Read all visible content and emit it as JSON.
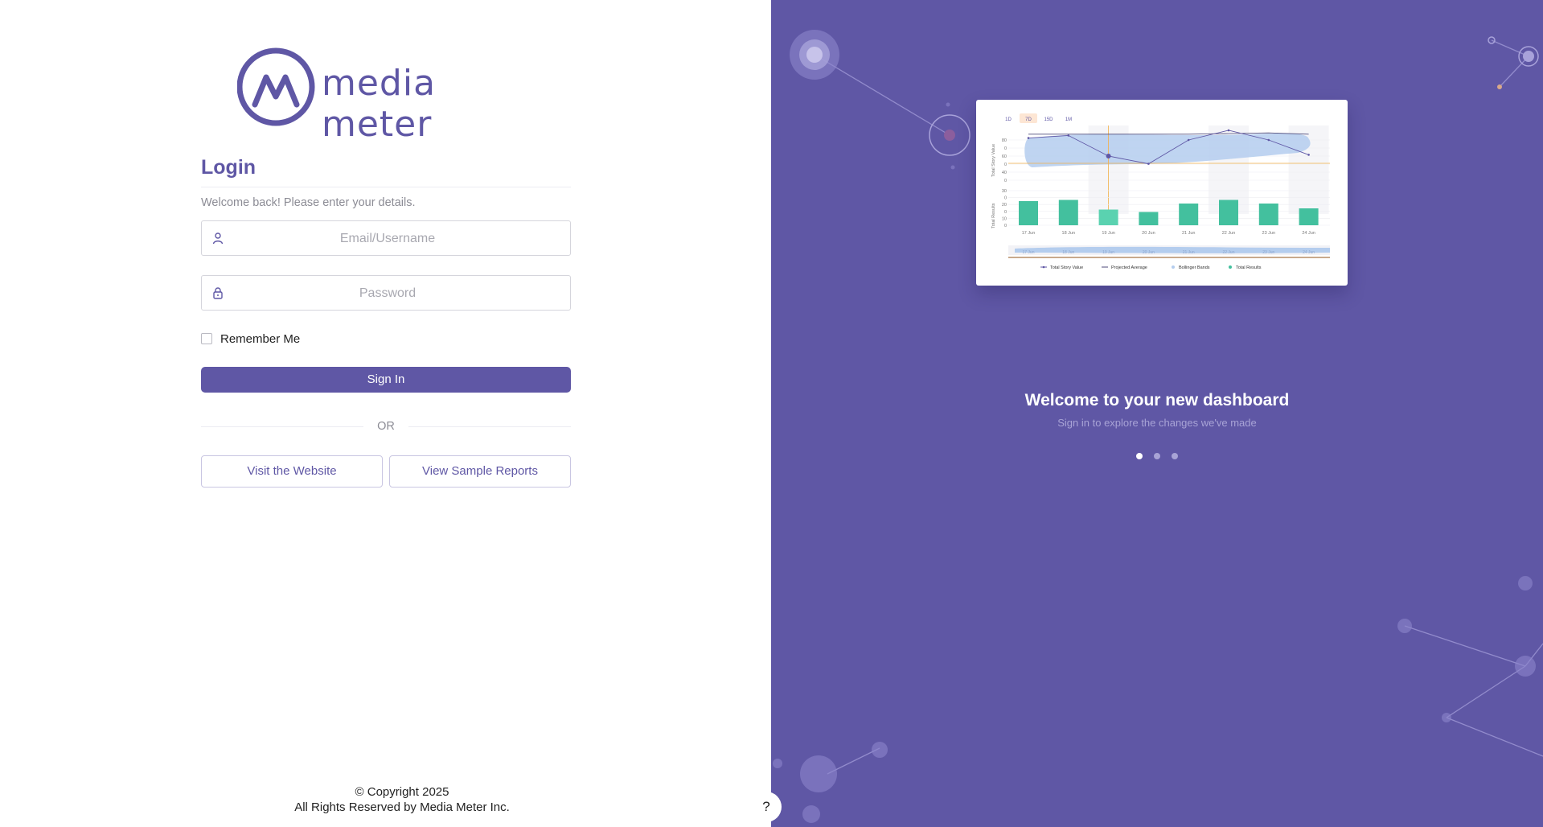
{
  "brand": {
    "logo_text": "media meter",
    "accent_color": "#5f57a5"
  },
  "login": {
    "title": "Login",
    "subtitle": "Welcome back! Please enter your details.",
    "email_placeholder": "Email/Username",
    "password_placeholder": "Password",
    "email_icon": "user-icon",
    "password_icon": "lock-icon",
    "remember_label": "Remember Me",
    "remember_checked": false,
    "signin_label": "Sign In",
    "or_label": "OR",
    "visit_label": "Visit the Website",
    "sample_label": "View Sample Reports"
  },
  "footer": {
    "copyright": "© Copyright 2025",
    "rights": "All Rights Reserved by Media Meter Inc."
  },
  "help": {
    "label": "?"
  },
  "promo": {
    "title": "Welcome to your new dashboard",
    "subtitle": "Sign in to explore the changes we've made",
    "slides": 3,
    "active_slide": 0
  },
  "preview_chart": {
    "range_tabs": [
      "1D",
      "7D",
      "15D",
      "1M"
    ],
    "active_tab": "7D",
    "categories": [
      "17 Jun",
      "18 Jun",
      "19 Jun",
      "20 Jun",
      "21 Jun",
      "22 Jun",
      "23 Jun",
      "24 Jun"
    ],
    "top_ylabel": "Total Story Value",
    "top_ticks": [
      "80",
      "0",
      "60",
      "0",
      "40",
      "0"
    ],
    "story_values": [
      58,
      62,
      30,
      18,
      55,
      70,
      55,
      32
    ],
    "projected_average": [
      64,
      64,
      64,
      64,
      64,
      65,
      66,
      64
    ],
    "bottom_ylabel": "Total Results",
    "bottom_ticks": [
      "30",
      "0",
      "20",
      "0",
      "10",
      "0"
    ],
    "results": [
      20,
      21,
      13,
      11,
      18,
      21,
      18,
      14
    ],
    "legend": [
      "Total Story Value",
      "Projected Average",
      "Bollinger Bands",
      "Total Results"
    ],
    "colors": {
      "line": "#5f57a5",
      "band": "#b4cdee",
      "bar": "#43c09e",
      "bar_highlight": "#5ad2b0",
      "marker": "#f2b04a"
    }
  }
}
